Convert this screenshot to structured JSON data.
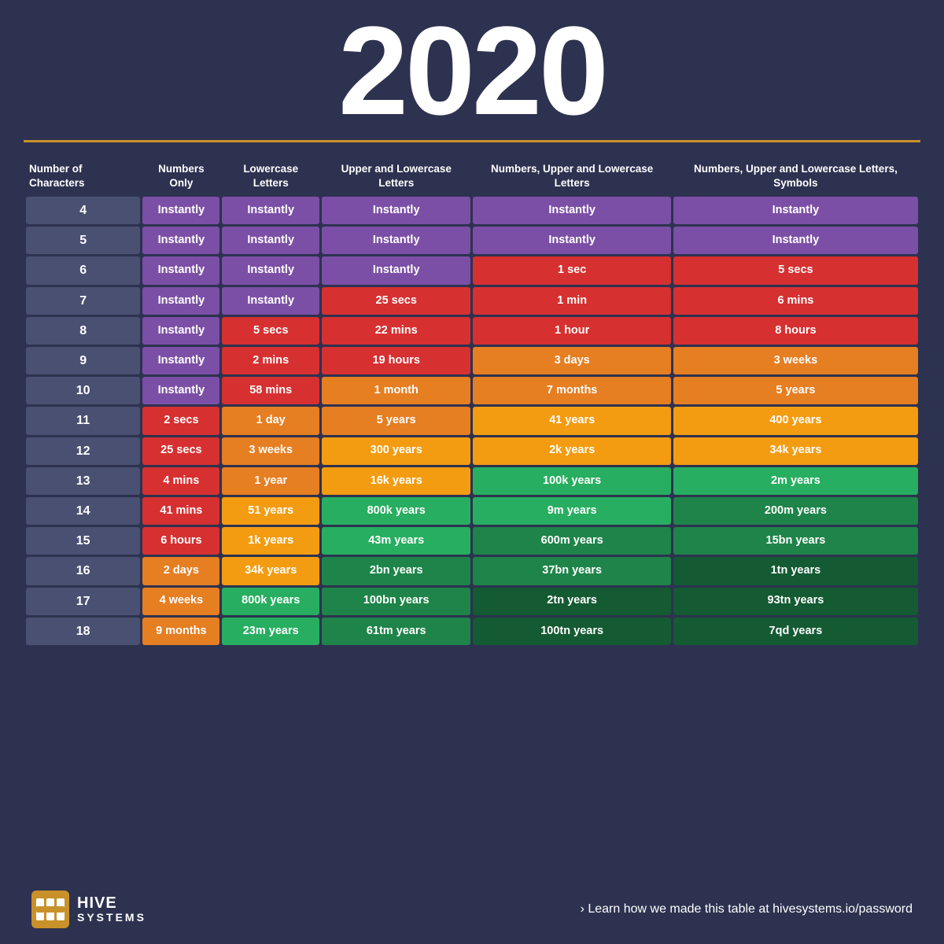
{
  "title": "2020",
  "divider": true,
  "table": {
    "headers": [
      "Number of Characters",
      "Numbers Only",
      "Lowercase Letters",
      "Upper and Lowercase Letters",
      "Numbers, Upper and Lowercase Letters",
      "Numbers, Upper and Lowercase Letters, Symbols"
    ],
    "rows": [
      {
        "chars": "4",
        "cols": [
          "Instantly",
          "Instantly",
          "Instantly",
          "Instantly",
          "Instantly"
        ],
        "colors": [
          "c-purple",
          "c-purple",
          "c-purple",
          "c-purple",
          "c-purple"
        ]
      },
      {
        "chars": "5",
        "cols": [
          "Instantly",
          "Instantly",
          "Instantly",
          "Instantly",
          "Instantly"
        ],
        "colors": [
          "c-purple",
          "c-purple",
          "c-purple",
          "c-purple",
          "c-purple"
        ]
      },
      {
        "chars": "6",
        "cols": [
          "Instantly",
          "Instantly",
          "Instantly",
          "1 sec",
          "5 secs"
        ],
        "colors": [
          "c-purple",
          "c-purple",
          "c-purple",
          "c-red",
          "c-red"
        ]
      },
      {
        "chars": "7",
        "cols": [
          "Instantly",
          "Instantly",
          "25 secs",
          "1 min",
          "6 mins"
        ],
        "colors": [
          "c-purple",
          "c-purple",
          "c-red",
          "c-red",
          "c-red"
        ]
      },
      {
        "chars": "8",
        "cols": [
          "Instantly",
          "5 secs",
          "22 mins",
          "1 hour",
          "8 hours"
        ],
        "colors": [
          "c-purple",
          "c-red",
          "c-red",
          "c-red",
          "c-red"
        ]
      },
      {
        "chars": "9",
        "cols": [
          "Instantly",
          "2 mins",
          "19 hours",
          "3 days",
          "3 weeks"
        ],
        "colors": [
          "c-purple",
          "c-red",
          "c-red",
          "c-orange",
          "c-orange"
        ]
      },
      {
        "chars": "10",
        "cols": [
          "Instantly",
          "58 mins",
          "1 month",
          "7 months",
          "5 years"
        ],
        "colors": [
          "c-purple",
          "c-red",
          "c-orange",
          "c-orange",
          "c-orange"
        ]
      },
      {
        "chars": "11",
        "cols": [
          "2 secs",
          "1 day",
          "5 years",
          "41 years",
          "400 years"
        ],
        "colors": [
          "c-red",
          "c-orange",
          "c-orange",
          "c-yellow-orange",
          "c-yellow-orange"
        ]
      },
      {
        "chars": "12",
        "cols": [
          "25 secs",
          "3 weeks",
          "300 years",
          "2k years",
          "34k years"
        ],
        "colors": [
          "c-red",
          "c-orange",
          "c-yellow-orange",
          "c-yellow-orange",
          "c-yellow-orange"
        ]
      },
      {
        "chars": "13",
        "cols": [
          "4 mins",
          "1 year",
          "16k years",
          "100k years",
          "2m years"
        ],
        "colors": [
          "c-red",
          "c-orange",
          "c-yellow-orange",
          "c-green-light",
          "c-green-light"
        ]
      },
      {
        "chars": "14",
        "cols": [
          "41 mins",
          "51 years",
          "800k years",
          "9m years",
          "200m years"
        ],
        "colors": [
          "c-red",
          "c-yellow-orange",
          "c-green-light",
          "c-green-light",
          "c-green"
        ]
      },
      {
        "chars": "15",
        "cols": [
          "6 hours",
          "1k years",
          "43m years",
          "600m years",
          "15bn years"
        ],
        "colors": [
          "c-red",
          "c-yellow-orange",
          "c-green-light",
          "c-green",
          "c-green"
        ]
      },
      {
        "chars": "16",
        "cols": [
          "2 days",
          "34k years",
          "2bn years",
          "37bn years",
          "1tn years"
        ],
        "colors": [
          "c-orange",
          "c-yellow-orange",
          "c-green",
          "c-green",
          "c-green-dark"
        ]
      },
      {
        "chars": "17",
        "cols": [
          "4 weeks",
          "800k years",
          "100bn years",
          "2tn years",
          "93tn years"
        ],
        "colors": [
          "c-orange",
          "c-green-light",
          "c-green",
          "c-green-dark",
          "c-green-dark"
        ]
      },
      {
        "chars": "18",
        "cols": [
          "9 months",
          "23m years",
          "61tm years",
          "100tn years",
          "7qd years"
        ],
        "colors": [
          "c-orange",
          "c-green-light",
          "c-green",
          "c-green-dark",
          "c-green-dark"
        ]
      }
    ]
  },
  "footer": {
    "logo_line1": "HIVE",
    "logo_line2": "SYSTEMS",
    "cta_arrow": "›",
    "cta_text": " Learn how we made this table at ",
    "cta_link": "hivesystems.io/password"
  }
}
